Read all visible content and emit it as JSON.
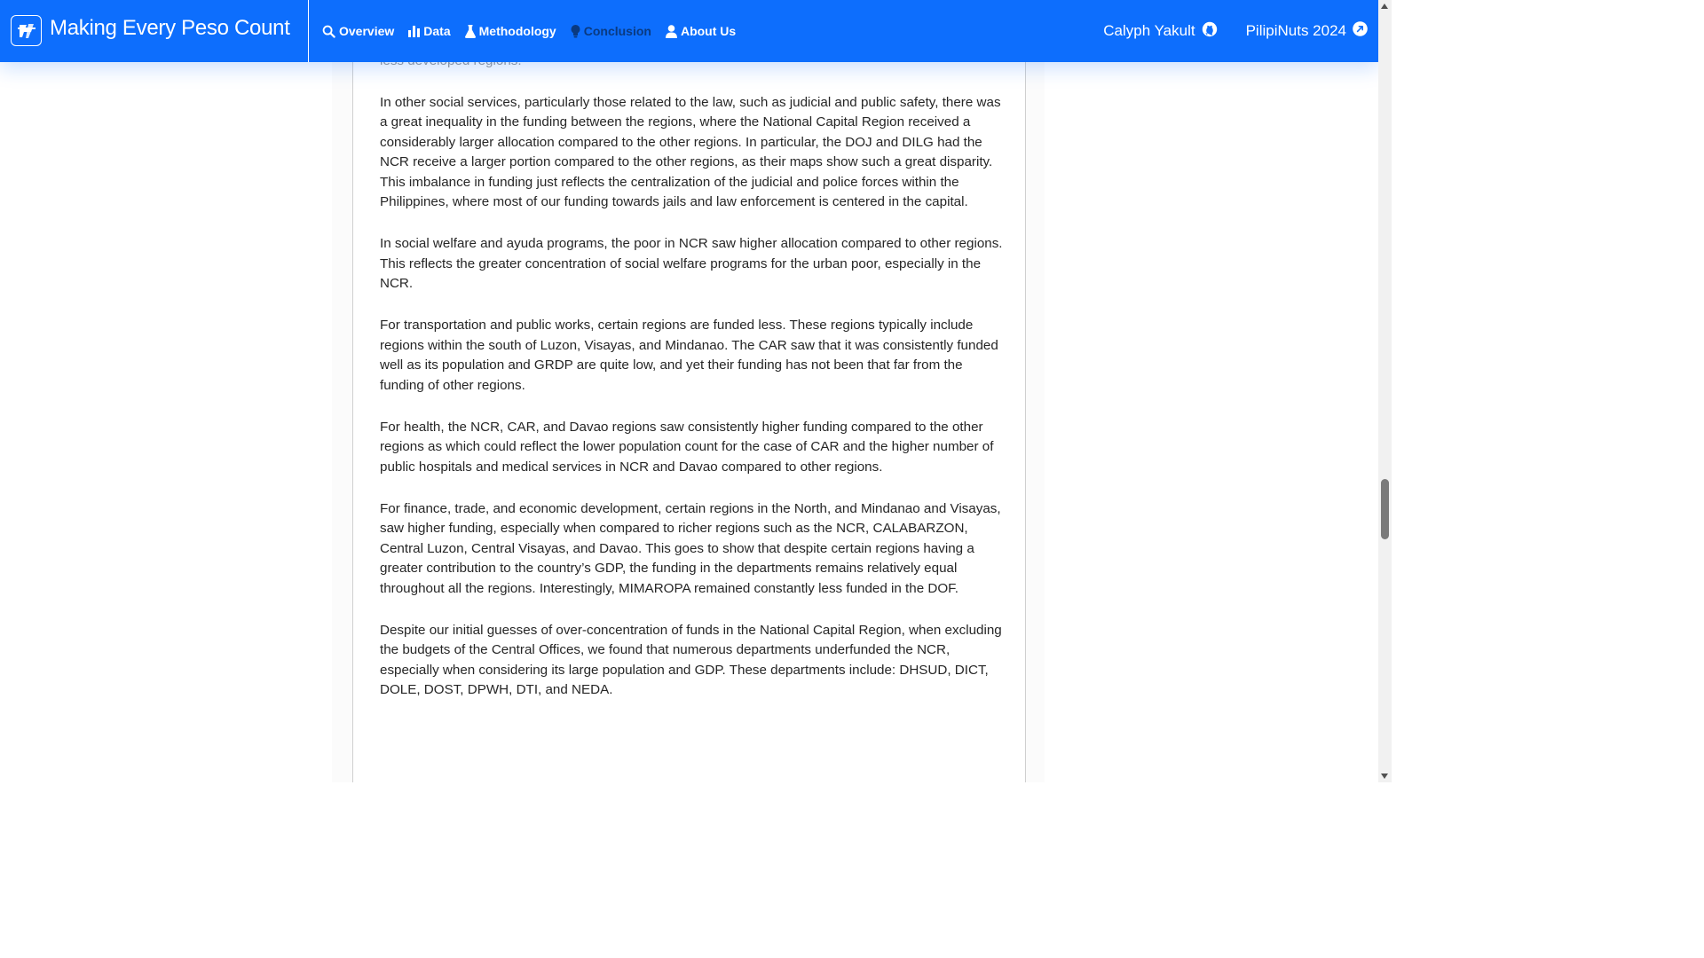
{
  "navbar": {
    "brand_title": "Making Every Peso Count",
    "links": [
      {
        "label": "Overview",
        "icon": "search-icon"
      },
      {
        "label": "Data",
        "icon": "bar-chart-icon"
      },
      {
        "label": "Methodology",
        "icon": "flask-icon"
      },
      {
        "label": "Conclusion",
        "icon": "lightbulb-icon",
        "active": true
      },
      {
        "label": "About Us",
        "icon": "person-icon"
      }
    ],
    "external": [
      {
        "label": "Calyph Yakult",
        "icon": "github-icon"
      },
      {
        "label": "PilipiNuts 2024",
        "icon": "external-link-icon"
      }
    ]
  },
  "content": {
    "faded_line": "less developed regions.",
    "paragraphs": [
      "In other social services, particularly those related to the law, such as judicial and public safety, there was a great inequality in the funding between the regions, where the National Capital Region received a considerably larger allocation compared to the other regions. In particular, the DOJ and DILG had the NCR receive a larger portion compared to the other regions, as their maps show such a great disparity. This imbalance in funding just reflects the centralization of the judicial and police forces within the Philippines, where most of our funding towards jails and law enforcement is centered in the capital.",
      "In social welfare and ayuda programs, the poor in NCR saw higher allocation compared to other regions. This reflects the greater concentration of social welfare programs for the urban poor, especially in the NCR.",
      "For transportation and public works, certain regions are funded less. These regions typically include regions within the south of Luzon, Visayas, and Mindanao. The CAR saw that it was consistently funded well as its population and GRDP are quite low, and yet their funding has not been that far from the funding of other regions.",
      "For health, the NCR, CAR, and Davao regions saw consistently higher funding compared to the other regions as which could reflect the lower population count for the case of CAR and the higher number of public hospitals and medical services in NCR and Davao compared to other regions.",
      "For finance, trade, and economic development, certain regions in the North, and Mindanao and Visayas, saw higher funding, especially when compared to richer regions such as the NCR, CALABARZON, Central Luzon, Central Visayas, and Davao. This goes to show that despite certain regions having a greater contribution to the country’s GDP, the funding in the departments remains relatively equal throughout all the regions. Interestingly, MIMAROPA remained constantly less funded in the DOF.",
      "Despite our initial guesses of over-concentration of funds in the National Capital Region, when excluding the budgets of the Central Offices, we found that numerous departments underfunded the NCR, especially when considering its large population and GDP. These departments include: DHSUD, DICT, DOLE, DOST, DPWH, DTI, and NEDA."
    ]
  },
  "colors": {
    "navbar_bg": "#0d6efd",
    "active_link": "#0a3a80",
    "body_text": "#262626"
  }
}
